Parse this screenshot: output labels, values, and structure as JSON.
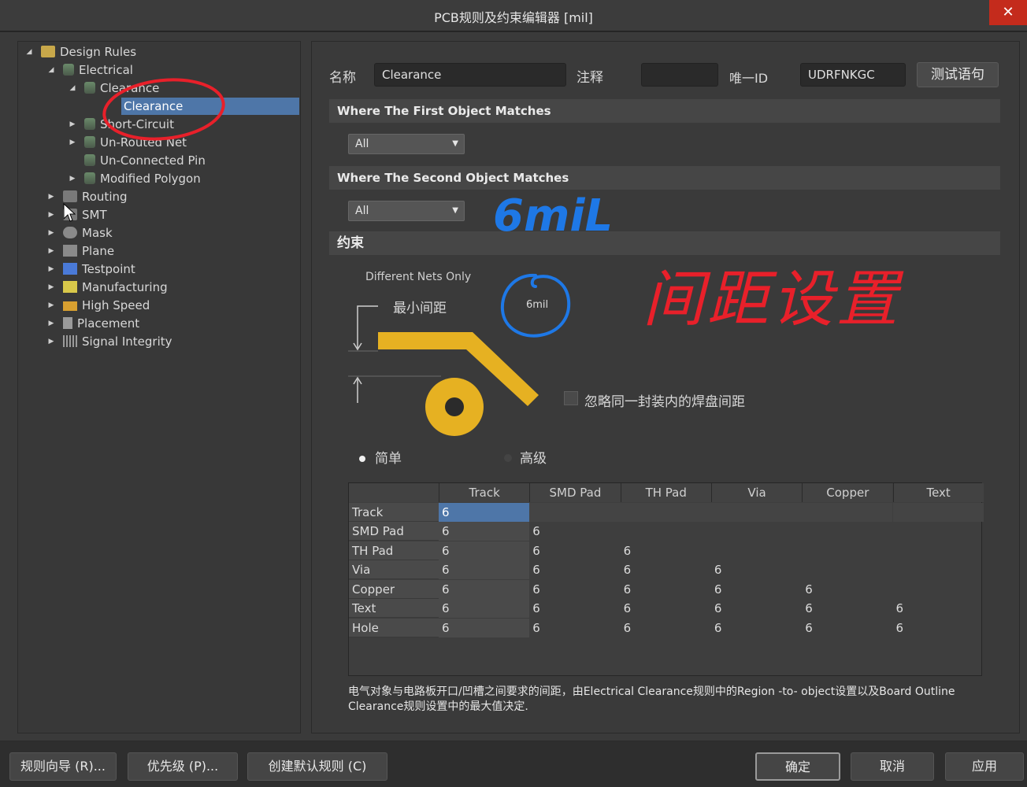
{
  "window": {
    "title": "PCB规则及约束编辑器 [mil]",
    "close_label": "✕"
  },
  "tree": {
    "items": [
      {
        "label": "Design Rules",
        "icon": "design-rules-folder-icon"
      },
      {
        "label": "Electrical",
        "icon": "rule-category-icon"
      },
      {
        "label": "Clearance",
        "icon": "rule-category-icon"
      },
      {
        "label": "Clearance",
        "icon": "rule-icon",
        "selected": true
      },
      {
        "label": "Short-Circuit",
        "icon": "rule-category-icon"
      },
      {
        "label": "Un-Routed Net",
        "icon": "rule-category-icon"
      },
      {
        "label": "Un-Connected Pin",
        "icon": "rule-category-icon"
      },
      {
        "label": "Modified Polygon",
        "icon": "rule-category-icon"
      },
      {
        "label": "Routing",
        "icon": "routing-icon"
      },
      {
        "label": "SMT",
        "icon": "smt-icon"
      },
      {
        "label": "Mask",
        "icon": "mask-icon"
      },
      {
        "label": "Plane",
        "icon": "plane-icon"
      },
      {
        "label": "Testpoint",
        "icon": "testpoint-icon"
      },
      {
        "label": "Manufacturing",
        "icon": "manufacturing-icon"
      },
      {
        "label": "High Speed",
        "icon": "high-speed-icon"
      },
      {
        "label": "Placement",
        "icon": "placement-icon"
      },
      {
        "label": "Signal Integrity",
        "icon": "signal-integrity-icon"
      }
    ]
  },
  "rule": {
    "name_label": "名称",
    "name_value": "Clearance",
    "comment_label": "注释",
    "comment_value": "",
    "id_label": "唯一ID",
    "id_value": "UDRFNKGC",
    "test_button": "测试语句"
  },
  "first_match": {
    "header": "Where The First Object Matches",
    "dropdown_value": "All"
  },
  "second_match": {
    "header": "Where The Second Object Matches",
    "dropdown_value": "All"
  },
  "constraints": {
    "header": "约束",
    "scope_label": "Different Nets Only",
    "min_clearance_label": "最小间距",
    "min_clearance_value": "6mil",
    "ignore_pad_label": "忽略同一封装内的焊盘间距",
    "ignore_pad_checked": false,
    "mode_simple": "简单",
    "mode_advanced": "高级",
    "mode_selected": "简单"
  },
  "clearance_matrix": {
    "columns": [
      "Track",
      "SMD Pad",
      "TH Pad",
      "Via",
      "Copper",
      "Text"
    ],
    "rows": [
      {
        "label": "Track",
        "values": [
          "6",
          "",
          "",
          "",
          "",
          ""
        ]
      },
      {
        "label": "SMD Pad",
        "values": [
          "6",
          "6",
          "",
          "",
          "",
          ""
        ]
      },
      {
        "label": "TH Pad",
        "values": [
          "6",
          "6",
          "6",
          "",
          "",
          ""
        ]
      },
      {
        "label": "Via",
        "values": [
          "6",
          "6",
          "6",
          "6",
          "",
          ""
        ]
      },
      {
        "label": "Copper",
        "values": [
          "6",
          "6",
          "6",
          "6",
          "6",
          ""
        ]
      },
      {
        "label": "Text",
        "values": [
          "6",
          "6",
          "6",
          "6",
          "6",
          "6"
        ]
      },
      {
        "label": "Hole",
        "values": [
          "6",
          "6",
          "6",
          "6",
          "6",
          "6"
        ]
      }
    ]
  },
  "description": "电气对象与电路板开口/凹槽之间要求的间距，由Electrical Clearance规则中的Region -to- object设置以及Board Outline Clearance规则设置中的最大值决定.",
  "annotations": {
    "blue_text": "6miL",
    "red_text": "间距设置"
  },
  "footer": {
    "rule_wizard": "规则向导 (R)...",
    "priority": "优先级 (P)...",
    "create_default": "创建默认规则 (C)",
    "ok": "确定",
    "cancel": "取消",
    "apply": "应用"
  },
  "colors": {
    "copper": "#e6b122",
    "selection": "#4e76a8",
    "annotation_red": "#e8202a",
    "annotation_blue": "#1e78e6"
  }
}
